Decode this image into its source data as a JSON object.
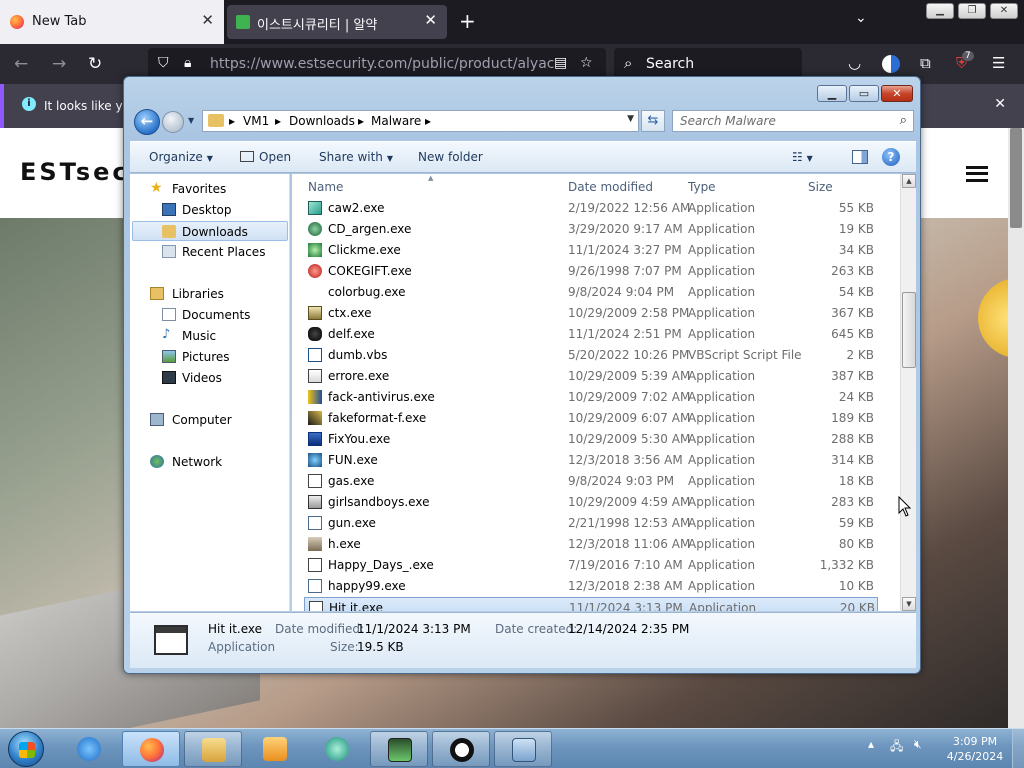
{
  "browser": {
    "tabs": [
      {
        "label": "New Tab"
      },
      {
        "label": "이스트시큐리티 | 알약"
      }
    ],
    "url": "https://www.estsecurity.com/public/product/alyac",
    "search_label": "Search",
    "notification_text": "It looks like you",
    "extension_badge": "7"
  },
  "webpage": {
    "logo_text": "ESTsec"
  },
  "explorer": {
    "breadcrumb": [
      "VM1",
      "Downloads",
      "Malware"
    ],
    "search_placeholder": "Search Malware",
    "toolbar": {
      "organize": "Organize",
      "open": "Open",
      "share_with": "Share with",
      "new_folder": "New folder"
    },
    "nav": {
      "favorites": "Favorites",
      "desktop": "Desktop",
      "downloads": "Downloads",
      "recent_places": "Recent Places",
      "libraries": "Libraries",
      "documents": "Documents",
      "music": "Music",
      "pictures": "Pictures",
      "videos": "Videos",
      "computer": "Computer",
      "network": "Network"
    },
    "columns": {
      "name": "Name",
      "date": "Date modified",
      "type": "Type",
      "size": "Size"
    },
    "files": [
      {
        "name": "caw2.exe",
        "date": "2/19/2022 12:56 AM",
        "type": "Application",
        "size": "55 KB"
      },
      {
        "name": "CD_argen.exe",
        "date": "3/29/2020 9:17 AM",
        "type": "Application",
        "size": "19 KB"
      },
      {
        "name": "Clickme.exe",
        "date": "11/1/2024 3:27 PM",
        "type": "Application",
        "size": "34 KB"
      },
      {
        "name": "COKEGIFT.exe",
        "date": "9/26/1998 7:07 PM",
        "type": "Application",
        "size": "263 KB"
      },
      {
        "name": "colorbug.exe",
        "date": "9/8/2024 9:04 PM",
        "type": "Application",
        "size": "54 KB"
      },
      {
        "name": "ctx.exe",
        "date": "10/29/2009 2:58 PM",
        "type": "Application",
        "size": "367 KB"
      },
      {
        "name": "delf.exe",
        "date": "11/1/2024 2:51 PM",
        "type": "Application",
        "size": "645 KB"
      },
      {
        "name": "dumb.vbs",
        "date": "5/20/2022 10:26 PM",
        "type": "VBScript Script File",
        "size": "2 KB"
      },
      {
        "name": "errore.exe",
        "date": "10/29/2009 5:39 AM",
        "type": "Application",
        "size": "387 KB"
      },
      {
        "name": "fack-antivirus.exe",
        "date": "10/29/2009 7:02 AM",
        "type": "Application",
        "size": "24 KB"
      },
      {
        "name": "fakeformat-f.exe",
        "date": "10/29/2009 6:07 AM",
        "type": "Application",
        "size": "189 KB"
      },
      {
        "name": "FixYou.exe",
        "date": "10/29/2009 5:30 AM",
        "type": "Application",
        "size": "288 KB"
      },
      {
        "name": "FUN.exe",
        "date": "12/3/2018 3:56 AM",
        "type": "Application",
        "size": "314 KB"
      },
      {
        "name": "gas.exe",
        "date": "9/8/2024 9:03 PM",
        "type": "Application",
        "size": "18 KB"
      },
      {
        "name": "girlsandboys.exe",
        "date": "10/29/2009 4:59 AM",
        "type": "Application",
        "size": "283 KB"
      },
      {
        "name": "gun.exe",
        "date": "2/21/1998 12:53 AM",
        "type": "Application",
        "size": "59 KB"
      },
      {
        "name": "h.exe",
        "date": "12/3/2018 11:06 AM",
        "type": "Application",
        "size": "80 KB"
      },
      {
        "name": "Happy_Days_.exe",
        "date": "7/19/2016 7:10 AM",
        "type": "Application",
        "size": "1,332 KB"
      },
      {
        "name": "happy99.exe",
        "date": "12/3/2018 2:38 AM",
        "type": "Application",
        "size": "10 KB"
      },
      {
        "name": "Hit it.exe",
        "date": "11/1/2024 3:13 PM",
        "type": "Application",
        "size": "20 KB"
      }
    ],
    "details": {
      "name": "Hit it.exe",
      "type": "Application",
      "date_modified_label": "Date modified:",
      "date_modified": "11/1/2024 3:13 PM",
      "date_created_label": "Date created:",
      "date_created": "12/14/2024 2:35 PM",
      "size_label": "Size:",
      "size": "19.5 KB"
    }
  },
  "taskbar": {
    "time": "3:09 PM",
    "date": "4/26/2024"
  },
  "colors": {
    "firefox_dark": "#1c1b22",
    "explorer_frame": "#a9c5e2",
    "selection": "#c5dcf4",
    "taskbar": "#6d95bd"
  }
}
